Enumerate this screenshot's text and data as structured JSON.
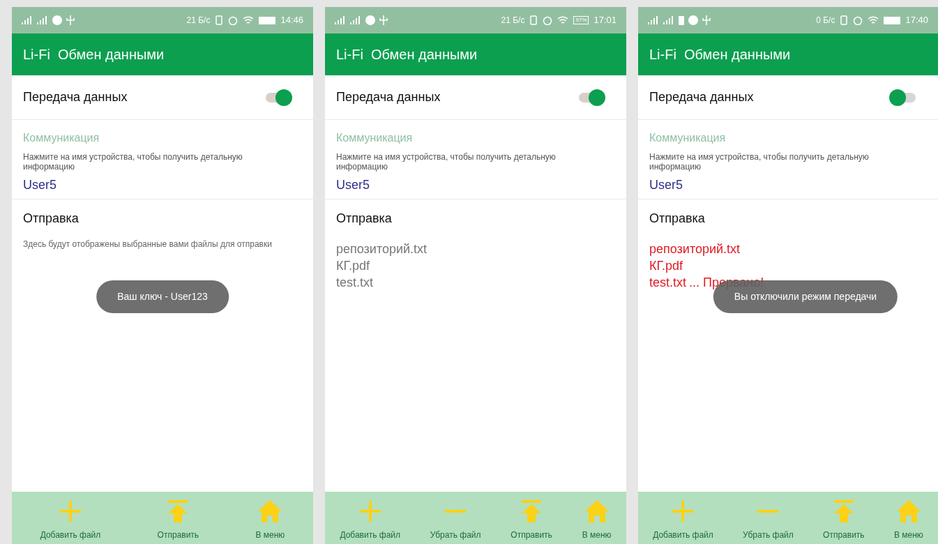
{
  "screens": [
    {
      "status_bar": {
        "extra_battery": false,
        "speed": "21 Б/с",
        "time": "14:46"
      },
      "app_bar": {
        "title": "Li-Fi  Обмен данными"
      },
      "transfer": {
        "label": "Передача данных",
        "on": true
      },
      "communication": {
        "heading": "Коммуникация",
        "hint": "Нажмите на имя устройства, чтобы получить детальную информацию",
        "device": "User5"
      },
      "sending": {
        "heading": "Отправка",
        "empty_hint": "Здесь будут отображены выбранные вами файлы для отправки"
      },
      "toast": "Ваш ключ - User123",
      "actions": [
        {
          "kind": "plus",
          "label": "Добавить файл"
        },
        {
          "kind": "upload",
          "label": "Отправить"
        },
        {
          "kind": "home",
          "label": "В меню"
        }
      ]
    },
    {
      "status_bar": {
        "extra_battery": false,
        "speed": "21 Б/с",
        "battery_label": "97%",
        "time": "17:01"
      },
      "app_bar": {
        "title": "Li-Fi  Обмен данными"
      },
      "transfer": {
        "label": "Передача данных",
        "on": true
      },
      "communication": {
        "heading": "Коммуникация",
        "hint": "Нажмите на имя устройства, чтобы получить детальную информацию",
        "device": "User5"
      },
      "sending": {
        "heading": "Отправка",
        "files": [
          {
            "name": "репозиторий.txt",
            "failed": false
          },
          {
            "name": "КГ.pdf",
            "failed": false
          },
          {
            "name": "test.txt",
            "failed": false
          }
        ]
      },
      "actions": [
        {
          "kind": "plus",
          "label": "Добавить файл"
        },
        {
          "kind": "minus",
          "label": "Убрать файл"
        },
        {
          "kind": "upload",
          "label": "Отправить"
        },
        {
          "kind": "home",
          "label": "В меню"
        }
      ]
    },
    {
      "status_bar": {
        "extra_battery": true,
        "speed": "0 Б/с",
        "time": "17:40"
      },
      "app_bar": {
        "title": "Li-Fi  Обмен данными"
      },
      "transfer": {
        "label": "Передача данных",
        "on": false
      },
      "communication": {
        "heading": "Коммуникация",
        "hint": "Нажмите на имя устройства, чтобы получить детальную информацию",
        "device": "User5"
      },
      "sending": {
        "heading": "Отправка",
        "files": [
          {
            "name": "репозиторий.txt",
            "failed": true
          },
          {
            "name": "КГ.pdf",
            "failed": true
          },
          {
            "name": "test.txt",
            "failed": true,
            "status": "... Прервано!"
          }
        ]
      },
      "toast": "Вы отключили режим передачи",
      "actions": [
        {
          "kind": "plus",
          "label": "Добавить файл"
        },
        {
          "kind": "minus",
          "label": "Убрать файл"
        },
        {
          "kind": "upload",
          "label": "Отправить"
        },
        {
          "kind": "home",
          "label": "В меню"
        }
      ]
    }
  ]
}
